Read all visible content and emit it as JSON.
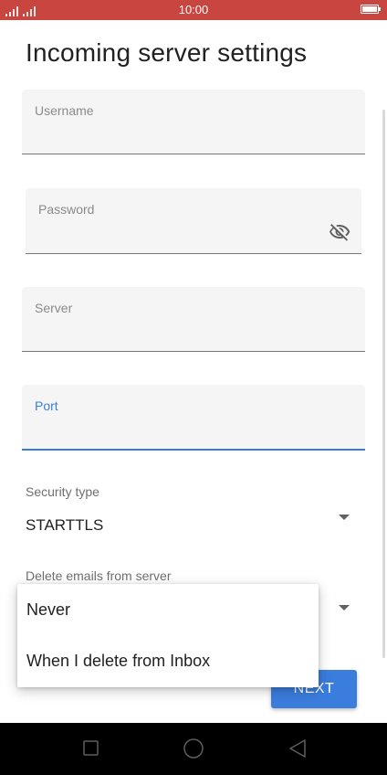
{
  "status_bar": {
    "time": "10:00"
  },
  "page": {
    "title": "Incoming server settings"
  },
  "fields": {
    "username": {
      "label": "Username"
    },
    "password": {
      "label": "Password"
    },
    "server": {
      "label": "Server"
    },
    "port": {
      "label": "Port"
    }
  },
  "security": {
    "label": "Security type",
    "value": "STARTTLS"
  },
  "delete_emails": {
    "label": "Delete emails from server",
    "options": [
      "Never",
      "When I delete from Inbox"
    ]
  },
  "next_button": {
    "label": "NEXT"
  },
  "colors": {
    "status_bar": "#c8463f",
    "accent": "#3b7ddd",
    "field_bg": "#f5f5f5"
  },
  "icons": [
    "signal-icon",
    "battery-icon",
    "eye-off-icon",
    "dropdown-arrow-icon",
    "recent-apps-icon",
    "home-icon",
    "back-icon"
  ]
}
